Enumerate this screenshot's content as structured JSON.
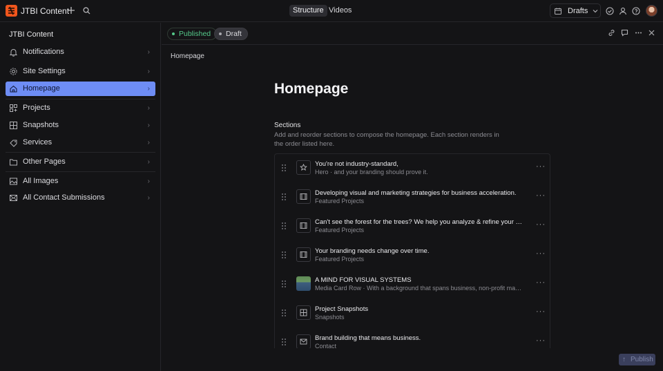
{
  "topbar": {
    "app_name": "JTBI Content",
    "tabs": [
      {
        "label": "Structure",
        "active": true
      },
      {
        "label": "Videos",
        "active": false
      }
    ],
    "perspective": "Drafts",
    "accent": "#f0561d"
  },
  "sidebar": {
    "title": "JTBI Content",
    "items": [
      {
        "label": "Notifications",
        "icon": "bell-icon"
      },
      {
        "label": "Site Settings",
        "icon": "gear-icon"
      },
      {
        "label": "Homepage",
        "icon": "home-icon",
        "active": true
      },
      {
        "label": "Projects",
        "icon": "projects-icon"
      },
      {
        "label": "Snapshots",
        "icon": "snapshot-icon"
      },
      {
        "label": "Services",
        "icon": "services-icon"
      },
      {
        "label": "Other Pages",
        "icon": "folder-icon"
      },
      {
        "label": "All Images",
        "icon": "image-icon"
      },
      {
        "label": "All Contact Submissions",
        "icon": "mail-icon"
      }
    ],
    "active_color": "#6e8df5"
  },
  "document": {
    "status_published": "Published",
    "status_draft": "Draft",
    "breadcrumb": "Homepage",
    "title": "Homepage",
    "sections_label": "Sections",
    "sections_description": "Add and reorder sections to compose the homepage. Each section renders in the order listed here.",
    "sections": [
      {
        "title": "You're not industry-standard,",
        "subtitle": "Hero · and your branding should prove it.",
        "icon": "star-icon"
      },
      {
        "title": "Developing visual and marketing strategies for business acceleration.",
        "subtitle": "Featured Projects",
        "icon": "featured-icon"
      },
      {
        "title": "Can't see the forest for the trees? We help you analyze & refine your br…",
        "subtitle": "Featured Projects",
        "icon": "featured-icon"
      },
      {
        "title": "Your branding needs change over time.",
        "subtitle": "Featured Projects",
        "icon": "featured-icon"
      },
      {
        "title": "A MIND FOR VISUAL SYSTEMS",
        "subtitle": "Media Card Row · With a background that spans business, non-profit ma…",
        "icon": "photo-thumbnail"
      },
      {
        "title": "Project Snapshots",
        "subtitle": "Snapshots",
        "icon": "snapshot-icon"
      },
      {
        "title": "Brand building that means business.",
        "subtitle": "Contact",
        "icon": "mail-icon"
      }
    ],
    "status_published_color": "#55c98a"
  },
  "footer": {
    "publish_label": "Publish"
  }
}
